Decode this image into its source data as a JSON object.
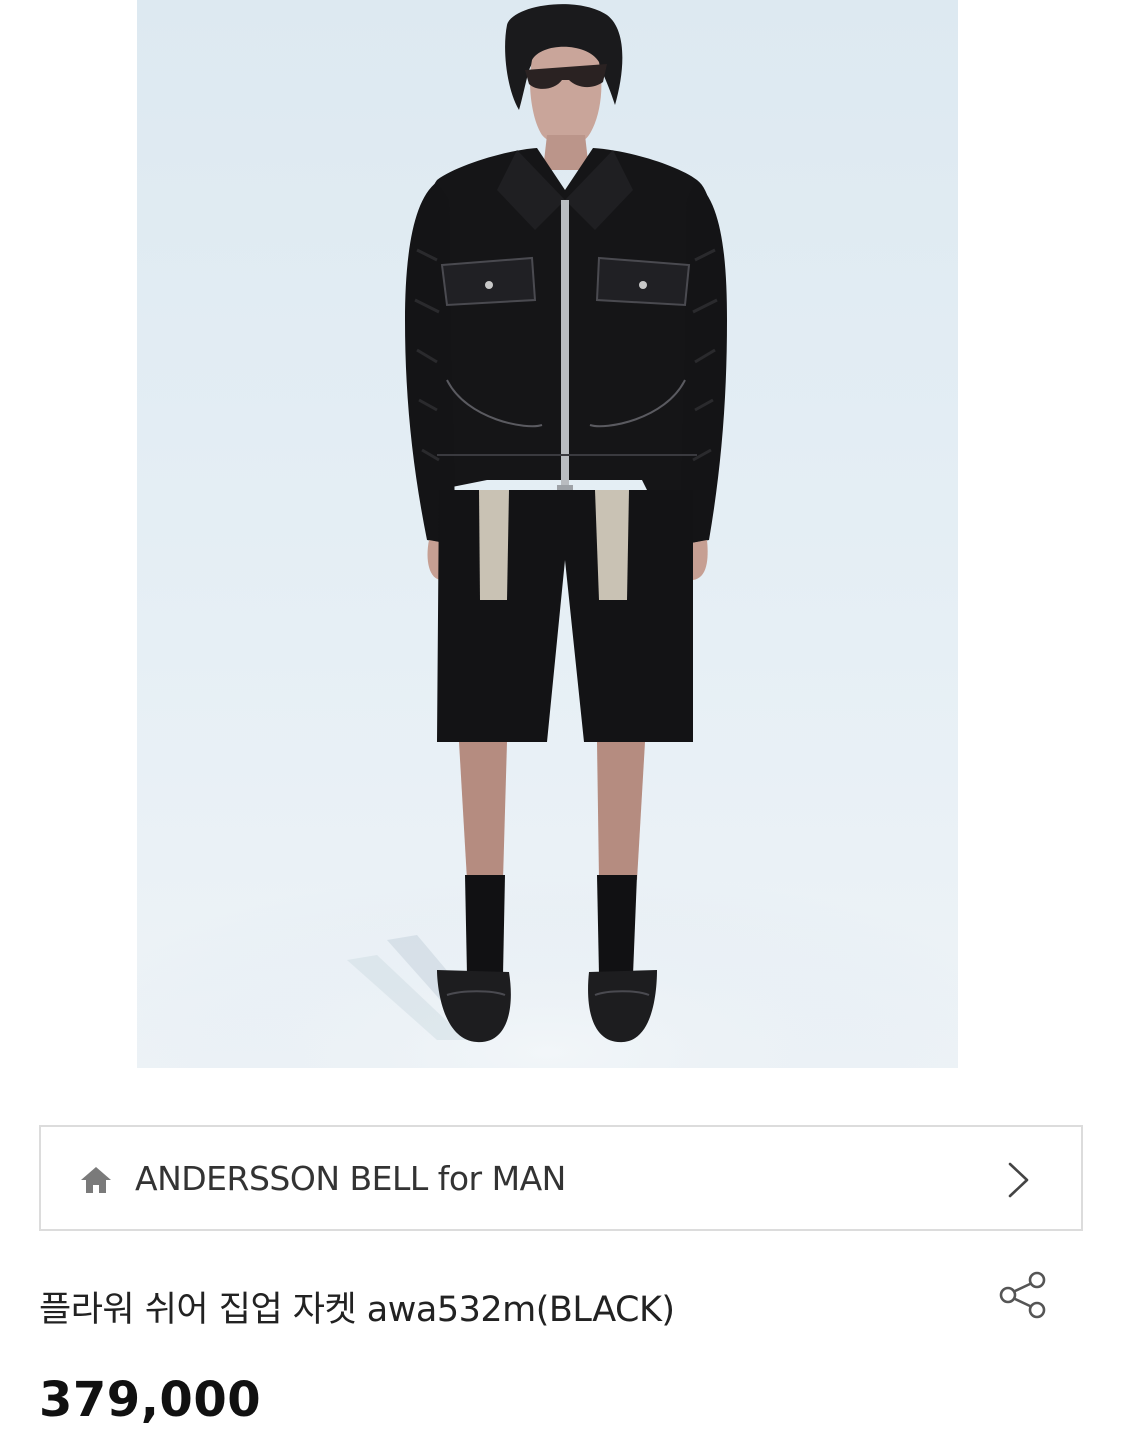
{
  "product_image": {
    "icon": "product-photo"
  },
  "brand": {
    "name": "ANDERSSON BELL for MAN",
    "icon": "home-icon",
    "chevron": "chevron-right-icon"
  },
  "product": {
    "title": "플라워 쉬어 집업 자켓 awa532m(BLACK)",
    "price": "379,000"
  },
  "actions": {
    "share_icon": "share-icon"
  },
  "colors": {
    "background": "#ffffff",
    "photo_bg": "#dfeaf2",
    "border": "#dcdcdc",
    "text": "#222222"
  }
}
